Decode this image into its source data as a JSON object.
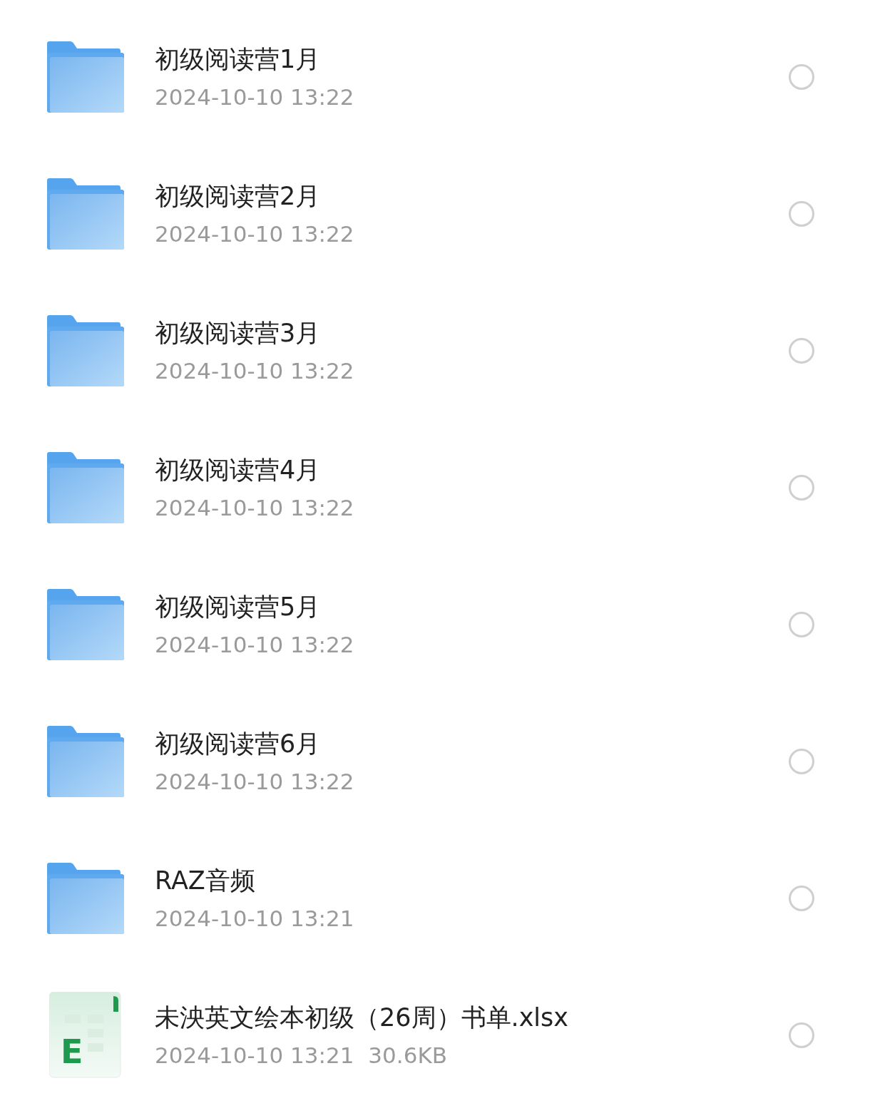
{
  "files": [
    {
      "kind": "folder",
      "name": "初级阅读营1月",
      "meta": [
        "2024-10-10 13:22"
      ],
      "selected": false
    },
    {
      "kind": "folder",
      "name": "初级阅读营2月",
      "meta": [
        "2024-10-10 13:22"
      ],
      "selected": false
    },
    {
      "kind": "folder",
      "name": "初级阅读营3月",
      "meta": [
        "2024-10-10 13:22"
      ],
      "selected": false
    },
    {
      "kind": "folder",
      "name": "初级阅读营4月",
      "meta": [
        "2024-10-10 13:22"
      ],
      "selected": false
    },
    {
      "kind": "folder",
      "name": "初级阅读营5月",
      "meta": [
        "2024-10-10 13:22"
      ],
      "selected": false
    },
    {
      "kind": "folder",
      "name": "初级阅读营6月",
      "meta": [
        "2024-10-10 13:22"
      ],
      "selected": false
    },
    {
      "kind": "folder",
      "name": "RAZ音频",
      "meta": [
        "2024-10-10 13:21"
      ],
      "selected": false
    },
    {
      "kind": "spreadsheet",
      "icon_letter": "E",
      "name": "未泱英文绘本初级（26周）书单.xlsx",
      "meta": [
        "2024-10-10 13:21",
        "30.6KB"
      ],
      "selected": false
    }
  ]
}
